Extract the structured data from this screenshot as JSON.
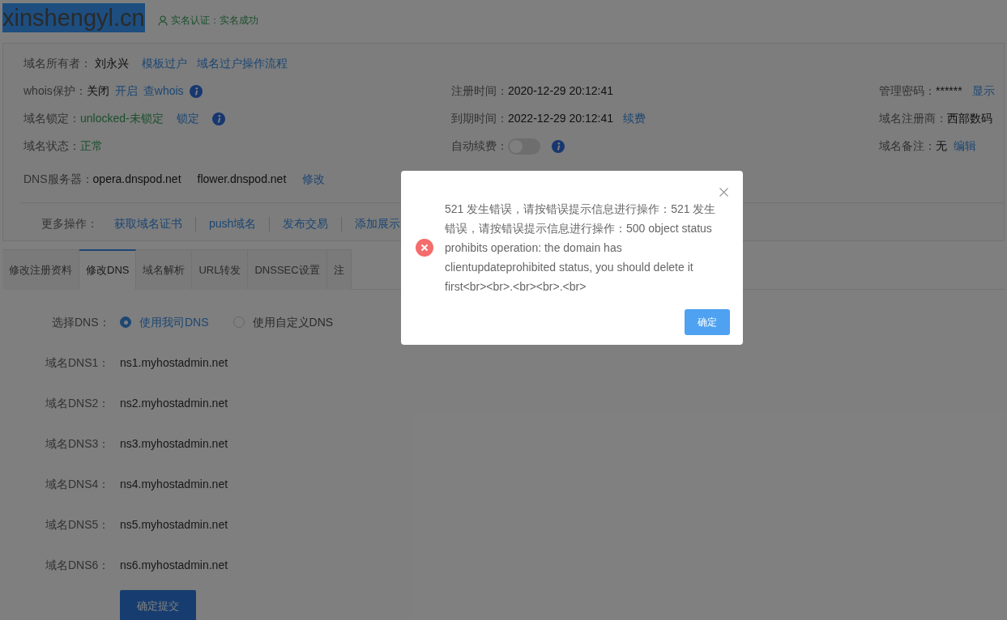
{
  "header": {
    "domain": "xinshengyl.cn",
    "verification": "实名认证：实名成功"
  },
  "info": {
    "owner": {
      "label": "域名所有者：",
      "value": "刘永兴",
      "links": [
        "模板过户",
        "域名过户操作流程"
      ]
    },
    "whois": {
      "label": "whois保护：",
      "value": "关闭",
      "links": [
        "开启",
        "查whois"
      ]
    },
    "lock": {
      "label": "域名锁定：",
      "value": "unlocked-未锁定",
      "links": [
        "锁定"
      ]
    },
    "status": {
      "label": "域名状态：",
      "value": "正常"
    },
    "dns_servers": {
      "label": "DNS服务器：",
      "values": [
        "opera.dnspod.net",
        "flower.dnspod.net"
      ],
      "link": "修改"
    },
    "registered": {
      "label": "注册时间：",
      "value": "2020-12-29 20:12:41"
    },
    "expires": {
      "label": "到期时间：",
      "value": "2022-12-29 20:12:41",
      "link": "续费"
    },
    "auto_renew": {
      "label": "自动续费：",
      "on": false
    },
    "password": {
      "label": "管理密码：",
      "value": "******",
      "link": "显示"
    },
    "registrar": {
      "label": "域名注册商：",
      "value": "西部数码"
    },
    "note": {
      "label": "域名备注：",
      "value": "无",
      "link": "编辑"
    }
  },
  "more_actions": {
    "label": "更多操作：",
    "items": [
      "获取域名证书",
      "push域名",
      "发布交易",
      "添加展示"
    ]
  },
  "tabs": [
    {
      "label": "修改注册资料",
      "selected": false
    },
    {
      "label": "修改DNS",
      "selected": true
    },
    {
      "label": "域名解析",
      "selected": false
    },
    {
      "label": "URL转发",
      "selected": false
    },
    {
      "label": "DNSSEC设置",
      "selected": false
    },
    {
      "label": "注",
      "selected": false
    }
  ],
  "dns_form": {
    "label": "选择DNS：",
    "options": [
      {
        "label": "使用我司DNS",
        "selected": true
      },
      {
        "label": "使用自定义DNS",
        "selected": false
      }
    ],
    "rows": [
      {
        "label": "域名DNS1：",
        "value": "ns1.myhostadmin.net"
      },
      {
        "label": "域名DNS2：",
        "value": "ns2.myhostadmin.net"
      },
      {
        "label": "域名DNS3：",
        "value": "ns3.myhostadmin.net"
      },
      {
        "label": "域名DNS4：",
        "value": "ns4.myhostadmin.net"
      },
      {
        "label": "域名DNS5：",
        "value": "ns5.myhostadmin.net"
      },
      {
        "label": "域名DNS6：",
        "value": "ns6.myhostadmin.net"
      }
    ],
    "submit": "确定提交"
  },
  "dialog": {
    "message": "521 发生错误，请按错误提示信息进行操作：521 发生错误，请按错误提示信息进行操作：500 object status prohibits operation: the domain has clientupdateprohibited status, you should delete it first<br><br>.<br><br>.<br>",
    "button": "确定"
  }
}
